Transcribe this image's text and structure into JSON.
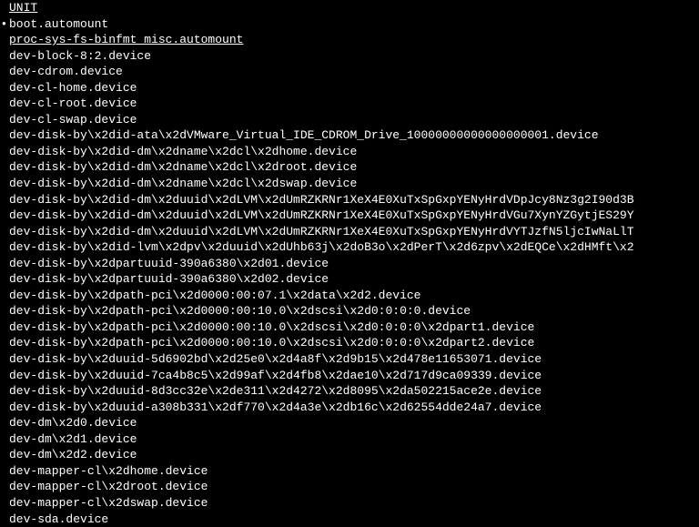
{
  "header": "UNIT",
  "units": [
    {
      "text": "boot.automount",
      "current": true,
      "underlined": false
    },
    {
      "text": "proc-sys-fs-binfmt_misc.automount",
      "current": false,
      "underlined": true
    },
    {
      "text": "dev-block-8:2.device",
      "current": false,
      "underlined": false
    },
    {
      "text": "dev-cdrom.device",
      "current": false,
      "underlined": false
    },
    {
      "text": "dev-cl-home.device",
      "current": false,
      "underlined": false
    },
    {
      "text": "dev-cl-root.device",
      "current": false,
      "underlined": false
    },
    {
      "text": "dev-cl-swap.device",
      "current": false,
      "underlined": false
    },
    {
      "text": "dev-disk-by\\x2did-ata\\x2dVMware_Virtual_IDE_CDROM_Drive_10000000000000000001.device",
      "current": false,
      "underlined": false
    },
    {
      "text": "dev-disk-by\\x2did-dm\\x2dname\\x2dcl\\x2dhome.device",
      "current": false,
      "underlined": false
    },
    {
      "text": "dev-disk-by\\x2did-dm\\x2dname\\x2dcl\\x2droot.device",
      "current": false,
      "underlined": false
    },
    {
      "text": "dev-disk-by\\x2did-dm\\x2dname\\x2dcl\\x2dswap.device",
      "current": false,
      "underlined": false
    },
    {
      "text": "dev-disk-by\\x2did-dm\\x2duuid\\x2dLVM\\x2dUmRZKRNr1XeX4E0XuTxSpGxpYENyHrdVDpJcy8Nz3g2I90d3B",
      "current": false,
      "underlined": false
    },
    {
      "text": "dev-disk-by\\x2did-dm\\x2duuid\\x2dLVM\\x2dUmRZKRNr1XeX4E0XuTxSpGxpYENyHrdVGu7XynYZGytjES29Y",
      "current": false,
      "underlined": false
    },
    {
      "text": "dev-disk-by\\x2did-dm\\x2duuid\\x2dLVM\\x2dUmRZKRNr1XeX4E0XuTxSpGxpYENyHrdVYTJzfN5ljcIwNaLlT",
      "current": false,
      "underlined": false
    },
    {
      "text": "dev-disk-by\\x2did-lvm\\x2dpv\\x2duuid\\x2dUhb63j\\x2doB3o\\x2dPerT\\x2d6zpv\\x2dEQCe\\x2dHMft\\x2",
      "current": false,
      "underlined": false
    },
    {
      "text": "dev-disk-by\\x2dpartuuid-390a6380\\x2d01.device",
      "current": false,
      "underlined": false
    },
    {
      "text": "dev-disk-by\\x2dpartuuid-390a6380\\x2d02.device",
      "current": false,
      "underlined": false
    },
    {
      "text": "dev-disk-by\\x2dpath-pci\\x2d0000:00:07.1\\x2data\\x2d2.device",
      "current": false,
      "underlined": false
    },
    {
      "text": "dev-disk-by\\x2dpath-pci\\x2d0000:00:10.0\\x2dscsi\\x2d0:0:0:0.device",
      "current": false,
      "underlined": false
    },
    {
      "text": "dev-disk-by\\x2dpath-pci\\x2d0000:00:10.0\\x2dscsi\\x2d0:0:0:0\\x2dpart1.device",
      "current": false,
      "underlined": false
    },
    {
      "text": "dev-disk-by\\x2dpath-pci\\x2d0000:00:10.0\\x2dscsi\\x2d0:0:0:0\\x2dpart2.device",
      "current": false,
      "underlined": false
    },
    {
      "text": "dev-disk-by\\x2duuid-5d6902bd\\x2d25e0\\x2d4a8f\\x2d9b15\\x2d478e11653071.device",
      "current": false,
      "underlined": false
    },
    {
      "text": "dev-disk-by\\x2duuid-7ca4b8c5\\x2d99af\\x2d4fb8\\x2dae10\\x2d717d9ca09339.device",
      "current": false,
      "underlined": false
    },
    {
      "text": "dev-disk-by\\x2duuid-8d3cc32e\\x2de311\\x2d4272\\x2d8095\\x2da502215ace2e.device",
      "current": false,
      "underlined": false
    },
    {
      "text": "dev-disk-by\\x2duuid-a308b331\\x2df770\\x2d4a3e\\x2db16c\\x2d62554dde24a7.device",
      "current": false,
      "underlined": false
    },
    {
      "text": "dev-dm\\x2d0.device",
      "current": false,
      "underlined": false
    },
    {
      "text": "dev-dm\\x2d1.device",
      "current": false,
      "underlined": false
    },
    {
      "text": "dev-dm\\x2d2.device",
      "current": false,
      "underlined": false
    },
    {
      "text": "dev-mapper-cl\\x2dhome.device",
      "current": false,
      "underlined": false
    },
    {
      "text": "dev-mapper-cl\\x2droot.device",
      "current": false,
      "underlined": false
    },
    {
      "text": "dev-mapper-cl\\x2dswap.device",
      "current": false,
      "underlined": false
    },
    {
      "text": "dev-sda.device",
      "current": false,
      "underlined": false
    }
  ]
}
